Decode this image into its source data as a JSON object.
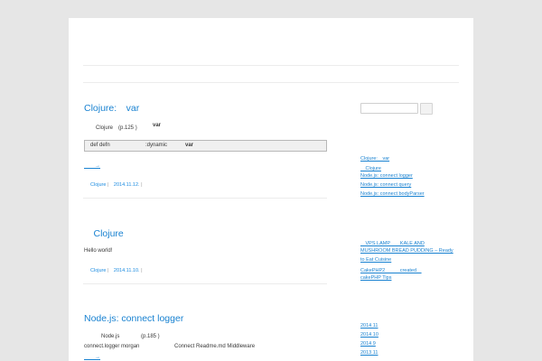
{
  "posts": [
    {
      "title": "Clojure:　var",
      "body_left": "Clojure　(p.125 )",
      "body_right": "var",
      "code": [
        "def defn",
        ":dynamic",
        "var"
      ],
      "more": "　　→",
      "category": "Clojure",
      "date": "2014.11.12."
    },
    {
      "title": "　Clojure",
      "body": "Hello world!",
      "category": "Clojure",
      "date": "2014.11.10."
    },
    {
      "title": "Node.js: connect logger",
      "line1_left": "Node.js",
      "line1_right": "(p.185 )",
      "line2_left": "connect.logger  morgan",
      "line2_right": "Connect Readme.md Middleware",
      "more": "　　→"
    }
  ],
  "sidebar": {
    "search_value": "",
    "recent_posts": [
      "Clojure:　var",
      "　Clojure",
      "Node.js: connect logger",
      "Node.js: connect query",
      "Node.js: connect bodyParser"
    ],
    "recent_comments": [
      "　VPS LAMP　　KALE AND",
      "MUSHROOM BREAD PUDDING – Ready",
      "to Eat Cuisine",
      "CakePHP2　　　created　",
      "cakePHP Tips"
    ],
    "archives": [
      "2014 11",
      "2014 10",
      "2014 9",
      "2013 11"
    ]
  }
}
